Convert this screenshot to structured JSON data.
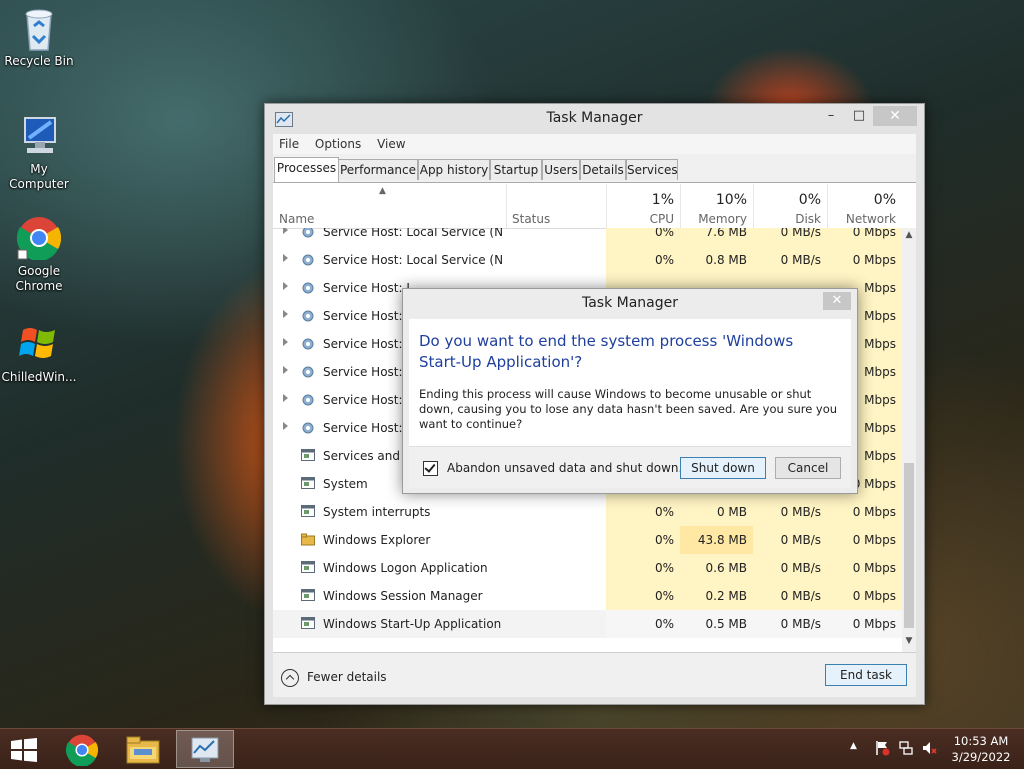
{
  "desktop": {
    "icons": [
      {
        "label": "Recycle Bin",
        "icon": "recycle-bin-icon"
      },
      {
        "label": "My Computer",
        "icon": "computer-icon"
      },
      {
        "label": "Google Chrome",
        "icon": "chrome-icon"
      },
      {
        "label": "ChilledWin...",
        "icon": "windows-flag-icon"
      }
    ]
  },
  "task_manager": {
    "title": "Task Manager",
    "window_buttons": {
      "minimize": "–",
      "maximize": "□",
      "close": "✕"
    },
    "menu": [
      "File",
      "Options",
      "View"
    ],
    "tabs": [
      "Processes",
      "Performance",
      "App history",
      "Startup",
      "Users",
      "Details",
      "Services"
    ],
    "active_tab": "Processes",
    "columns": {
      "name": "Name",
      "status": "Status",
      "cpu": {
        "pct": "1%",
        "label": "CPU"
      },
      "memory": {
        "pct": "10%",
        "label": "Memory"
      },
      "disk": {
        "pct": "0%",
        "label": "Disk"
      },
      "network": {
        "pct": "0%",
        "label": "Network"
      }
    },
    "rows": [
      {
        "name": "Service Host: Local Service (Net...",
        "cpu": "0%",
        "memory": "7.6 MB",
        "disk": "0 MB/s",
        "network": "0 Mbps",
        "expandable": true,
        "icon": "gear-icon"
      },
      {
        "name": "Service Host: Local Service (No I...",
        "cpu": "0%",
        "memory": "0.8 MB",
        "disk": "0 MB/s",
        "network": "0 Mbps",
        "expandable": true,
        "icon": "gear-icon"
      },
      {
        "name": "Service Host: L",
        "cpu": "",
        "memory": "",
        "disk": "",
        "network": "Mbps",
        "expandable": true,
        "icon": "gear-icon"
      },
      {
        "name": "Service Host: L",
        "cpu": "",
        "memory": "",
        "disk": "",
        "network": "Mbps",
        "expandable": true,
        "icon": "gear-icon"
      },
      {
        "name": "Service Host: L",
        "cpu": "",
        "memory": "",
        "disk": "",
        "network": "Mbps",
        "expandable": true,
        "icon": "gear-icon"
      },
      {
        "name": "Service Host: N",
        "cpu": "",
        "memory": "",
        "disk": "",
        "network": "Mbps",
        "expandable": true,
        "icon": "gear-icon"
      },
      {
        "name": "Service Host: N",
        "cpu": "",
        "memory": "",
        "disk": "",
        "network": "Mbps",
        "expandable": true,
        "icon": "gear-icon"
      },
      {
        "name": "Service Host: R",
        "cpu": "",
        "memory": "",
        "disk": "",
        "network": "Mbps",
        "expandable": true,
        "icon": "gear-icon"
      },
      {
        "name": "Services and Co",
        "cpu": "",
        "memory": "",
        "disk": "",
        "network": "Mbps",
        "expandable": false,
        "icon": "app-window-icon"
      },
      {
        "name": "System",
        "cpu": "",
        "memory": "",
        "disk": "",
        "network": "0 Mbps",
        "expandable": false,
        "icon": "app-window-icon"
      },
      {
        "name": "System interrupts",
        "cpu": "0%",
        "memory": "0 MB",
        "disk": "0 MB/s",
        "network": "0 Mbps",
        "expandable": false,
        "icon": "app-window-icon"
      },
      {
        "name": "Windows Explorer",
        "cpu": "0%",
        "memory": "43.8 MB",
        "disk": "0 MB/s",
        "network": "0 Mbps",
        "expandable": false,
        "icon": "folder-icon"
      },
      {
        "name": "Windows Logon Application",
        "cpu": "0%",
        "memory": "0.6 MB",
        "disk": "0 MB/s",
        "network": "0 Mbps",
        "expandable": false,
        "icon": "app-window-icon"
      },
      {
        "name": "Windows Session Manager",
        "cpu": "0%",
        "memory": "0.2 MB",
        "disk": "0 MB/s",
        "network": "0 Mbps",
        "expandable": false,
        "icon": "app-window-icon"
      },
      {
        "name": "Windows Start-Up Application",
        "cpu": "0%",
        "memory": "0.5 MB",
        "disk": "0 MB/s",
        "network": "0 Mbps",
        "expandable": false,
        "icon": "app-window-icon",
        "selected": true
      }
    ],
    "footer": {
      "fewer_details": "Fewer details",
      "end_task": "End task"
    }
  },
  "dialog": {
    "title": "Task Manager",
    "close": "✕",
    "heading": "Do you want to end the system process 'Windows Start-Up Application'?",
    "body": "Ending this process will cause Windows to become unusable or shut down, causing you to lose any data hasn't been saved. Are you sure you want to continue?",
    "checkbox_label": "Abandon unsaved data and shut down.",
    "checkbox_checked": true,
    "shutdown_button": "Shut down",
    "cancel_button": "Cancel"
  },
  "taskbar": {
    "clock_time": "10:53 AM",
    "clock_date": "3/29/2022",
    "tray_chevron": "▲"
  }
}
